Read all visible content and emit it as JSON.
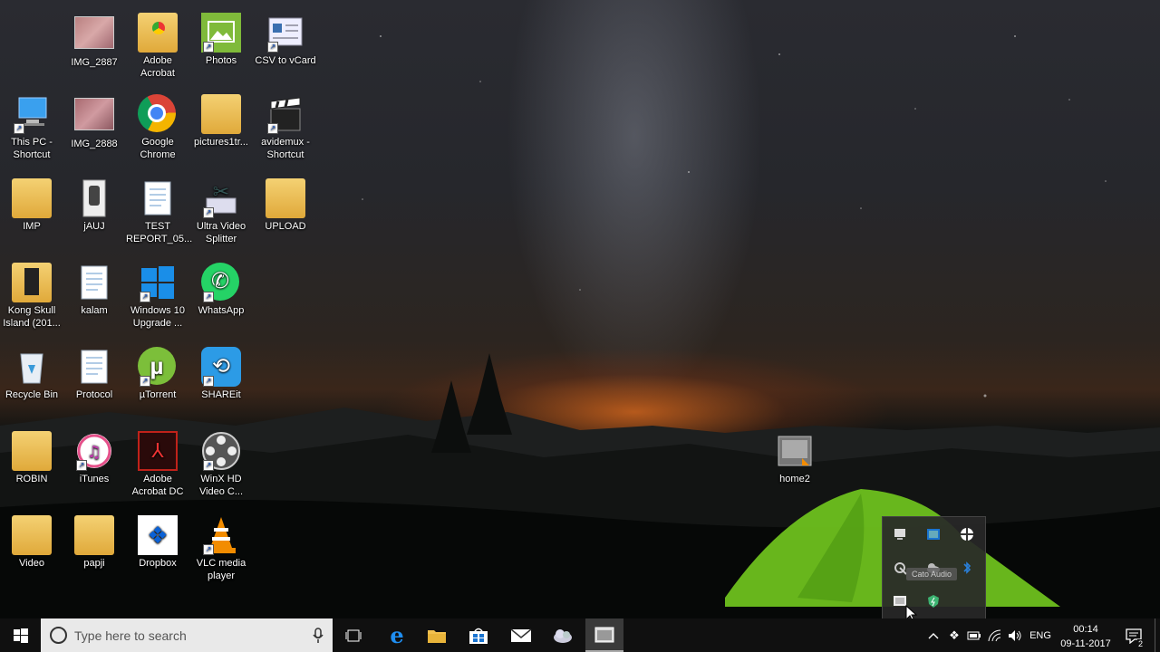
{
  "desktop_icons": {
    "img2887": "IMG_2887",
    "adobe_acrobat": "Adobe\nAcrobat",
    "photos": "Photos",
    "csv_vcard": "CSV to vCard",
    "this_pc": "This PC -\nShortcut",
    "img2888": "IMG_2888",
    "chrome": "Google\nChrome",
    "pictures": "pictures1tr...",
    "avidemux": "avidemux -\nShortcut",
    "imp": "IMP",
    "jauj": "jAUJ",
    "test_report": "TEST\nREPORT_05...",
    "ultra_video": "Ultra Video\nSplitter",
    "upload": "UPLOAD",
    "kong": "Kong Skull\nIsland (201...",
    "kalam": "kalam",
    "win10": "Windows 10\nUpgrade ...",
    "whatsapp": "WhatsApp",
    "recycle": "Recycle Bin",
    "protocol": "Protocol",
    "utorrent": "µTorrent",
    "shareit": "SHAREit",
    "robin": "ROBIN",
    "itunes": "iTunes",
    "acrobat_dc": "Adobe\nAcrobat DC",
    "winx": "WinX HD\nVideo C...",
    "video": "Video",
    "papji": "papji",
    "dropbox": "Dropbox",
    "vlc": "VLC media\nplayer",
    "home2": "home2"
  },
  "taskbar": {
    "search_placeholder": "Type here to search",
    "language": "ENG",
    "time": "00:14",
    "date": "09-11-2017",
    "notification_count": "2"
  },
  "overflow_tooltip": "Cato Audio",
  "colors": {
    "taskbar_bg": "#101010",
    "search_bg": "#e9e9e9",
    "tent_green": "#6ec01e",
    "accent_blue": "#1a74d1"
  }
}
